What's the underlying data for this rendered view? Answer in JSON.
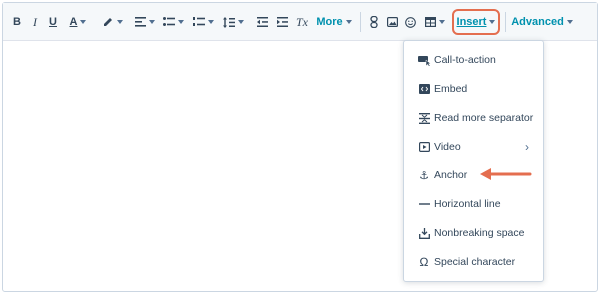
{
  "toolbar": {
    "more_label": "More",
    "insert_label": "Insert",
    "advanced_label": "Advanced",
    "buttons": {
      "bold": "B",
      "italic": "I",
      "underline": "U",
      "text_color": "A",
      "clear_formatting": "Tx"
    }
  },
  "insert_menu": {
    "items": [
      {
        "label": "Call-to-action",
        "icon": "cta-icon"
      },
      {
        "label": "Embed",
        "icon": "embed-icon"
      },
      {
        "label": "Read more separator",
        "icon": "read-more-icon"
      },
      {
        "label": "Video",
        "icon": "video-icon",
        "submenu": true
      },
      {
        "label": "Anchor",
        "icon": "anchor-icon"
      },
      {
        "label": "Horizontal line",
        "icon": "horizontal-line-icon"
      },
      {
        "label": "Nonbreaking space",
        "icon": "nonbreaking-space-icon"
      },
      {
        "label": "Special character",
        "icon": "omega-icon"
      }
    ]
  },
  "colors": {
    "accent": "#0091ae",
    "highlight": "#e46e4f",
    "text": "#33475b"
  }
}
